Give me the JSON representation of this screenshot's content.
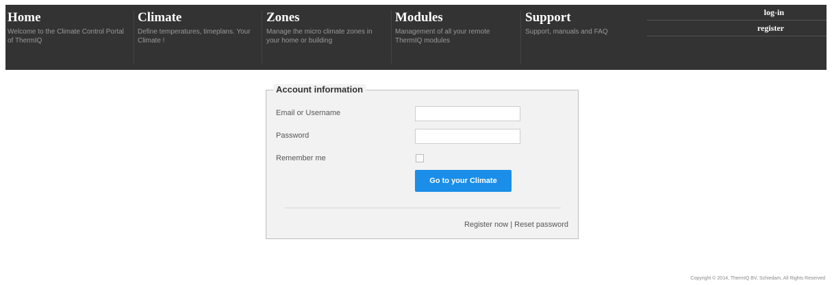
{
  "nav": {
    "items": [
      {
        "title": "Home",
        "desc": "Welcome to the Climate Control Portal of ThermIQ"
      },
      {
        "title": "Climate",
        "desc": "Define temperatures, timeplans. Your Climate !"
      },
      {
        "title": "Zones",
        "desc": "Manage the micro climate zones in your home or building"
      },
      {
        "title": "Modules",
        "desc": "Management of all your remote ThermIQ modules"
      },
      {
        "title": "Support",
        "desc": "Support, manuals and FAQ"
      }
    ],
    "login_label": "log-in",
    "register_label": "register"
  },
  "login": {
    "legend": "Account information",
    "email_label": "Email or Username",
    "email_value": "",
    "password_label": "Password",
    "password_value": "",
    "remember_label": "Remember me",
    "remember_checked": false,
    "submit_label": "Go to your Climate",
    "register_now": "Register now",
    "separator": "|",
    "reset_password": "Reset password"
  },
  "footer": {
    "copyright": "Copyright © 2014, ThermIQ BV, Schiedam, All Rights Reserved"
  }
}
